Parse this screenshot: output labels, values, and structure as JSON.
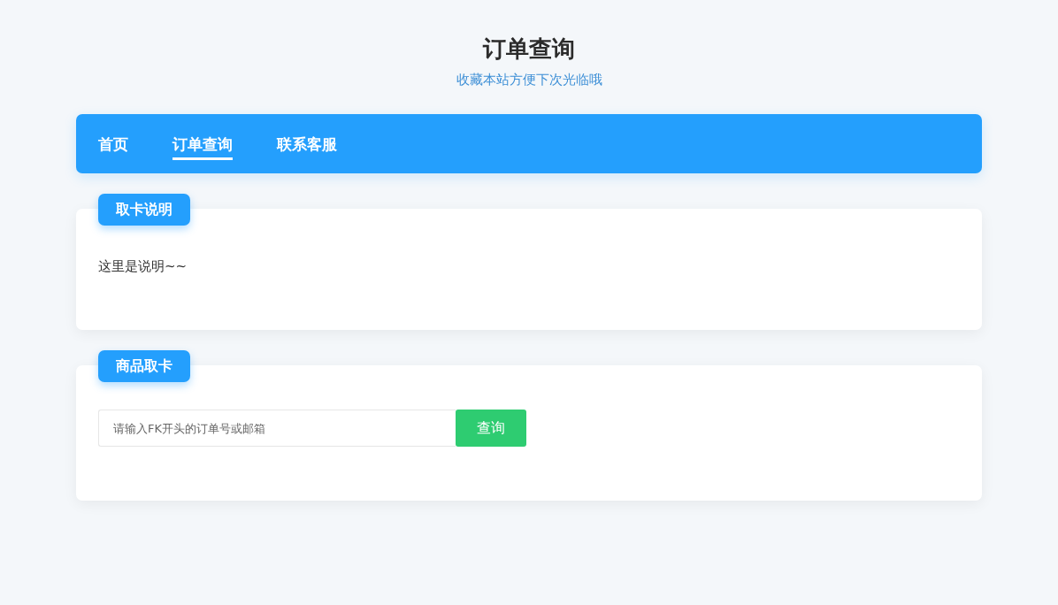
{
  "header": {
    "title": "订单查询",
    "subtitle": "收藏本站方便下次光临哦"
  },
  "nav": {
    "tabs": [
      {
        "label": "首页",
        "selected": false
      },
      {
        "label": "订单查询",
        "selected": true
      },
      {
        "label": "联系客服",
        "selected": false
      }
    ]
  },
  "sections": [
    {
      "kind": "text",
      "title": "取卡说明",
      "body": "这里是说明~~"
    },
    {
      "kind": "search",
      "title": "商品取卡",
      "placeholder": "请输入FK开头的订单号或邮箱",
      "button": "查询"
    }
  ]
}
